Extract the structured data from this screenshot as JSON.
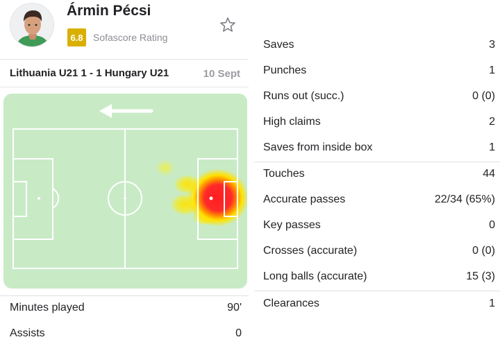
{
  "player": {
    "name": "Ármin Pécsi",
    "rating": "6.8",
    "rating_label": "Sofascore Rating"
  },
  "match": {
    "title": "Lithuania U21 1 - 1 Hungary U21",
    "date": "10 Sept"
  },
  "heatmap": {
    "attack_direction": "left"
  },
  "summary_stats": [
    {
      "label": "Minutes played",
      "value": "90'"
    },
    {
      "label": "Assists",
      "value": "0"
    }
  ],
  "goalkeeping_stats": [
    {
      "label": "Saves",
      "value": "3"
    },
    {
      "label": "Punches",
      "value": "1"
    },
    {
      "label": "Runs out (succ.)",
      "value": "0 (0)"
    },
    {
      "label": "High claims",
      "value": "2"
    },
    {
      "label": "Saves from inside box",
      "value": "1"
    }
  ],
  "passing_stats": [
    {
      "label": "Touches",
      "value": "44"
    },
    {
      "label": "Accurate passes",
      "value": "22/34 (65%)"
    },
    {
      "label": "Key passes",
      "value": "0"
    },
    {
      "label": "Crosses (accurate)",
      "value": "0 (0)"
    },
    {
      "label": "Long balls (accurate)",
      "value": "15 (3)"
    }
  ],
  "defending_stats": [
    {
      "label": "Clearances",
      "value": "1"
    }
  ],
  "colors": {
    "rating_badge": "#d9af00",
    "pitch": "#c8ebc6",
    "heat_hot": "#ff2a2a",
    "heat_warm": "#ffe100"
  }
}
